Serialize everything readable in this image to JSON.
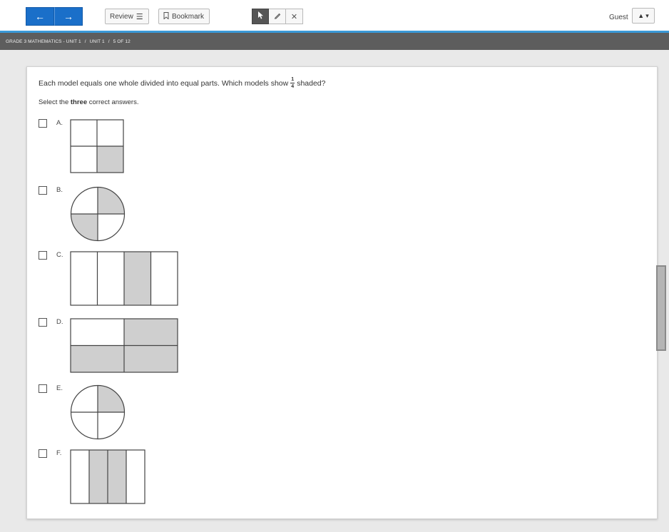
{
  "toolbar": {
    "back_icon": "left-arrow-icon",
    "forward_icon": "right-arrow-icon",
    "review_label": "Review",
    "bookmark_label": "Bookmark",
    "tools": [
      "pointer-icon",
      "highlighter-icon",
      "strikethrough-icon"
    ],
    "guest_label": "Guest",
    "accent_color": "#1a6fc9"
  },
  "breadcrumb": {
    "course": "GRADE 3 MATHEMATICS - UNIT 1",
    "separator": "/",
    "unit": "UNIT 1",
    "position": "5 OF 12"
  },
  "question": {
    "text_before": "Each model equals one whole divided into equal parts. Which models show",
    "fraction_numerator": "1",
    "fraction_denominator": "4",
    "text_after": "shaded?",
    "instruction_before": "Select the",
    "instruction_bold": "three",
    "instruction_after": "correct answers."
  },
  "options": [
    {
      "label": "A.",
      "model": "square-2x2",
      "shaded_parts": 1,
      "total_parts": 4
    },
    {
      "label": "B.",
      "model": "circle-quarters",
      "shaded_parts": 2,
      "total_parts": 4
    },
    {
      "label": "C.",
      "model": "rectangle-4-columns",
      "shaded_parts": 1,
      "total_parts": 4
    },
    {
      "label": "D.",
      "model": "rectangle-2x2",
      "shaded_parts": 3,
      "total_parts": 4
    },
    {
      "label": "E.",
      "model": "circle-quarters",
      "shaded_parts": 1,
      "total_parts": 4
    },
    {
      "label": "F.",
      "model": "rectangle-4-columns",
      "shaded_parts": 2,
      "total_parts": 4
    }
  ],
  "colors": {
    "shade": "#cfcfcf",
    "crumb_bar": "#5d5d5d",
    "accent_line": "#3a99d8"
  }
}
